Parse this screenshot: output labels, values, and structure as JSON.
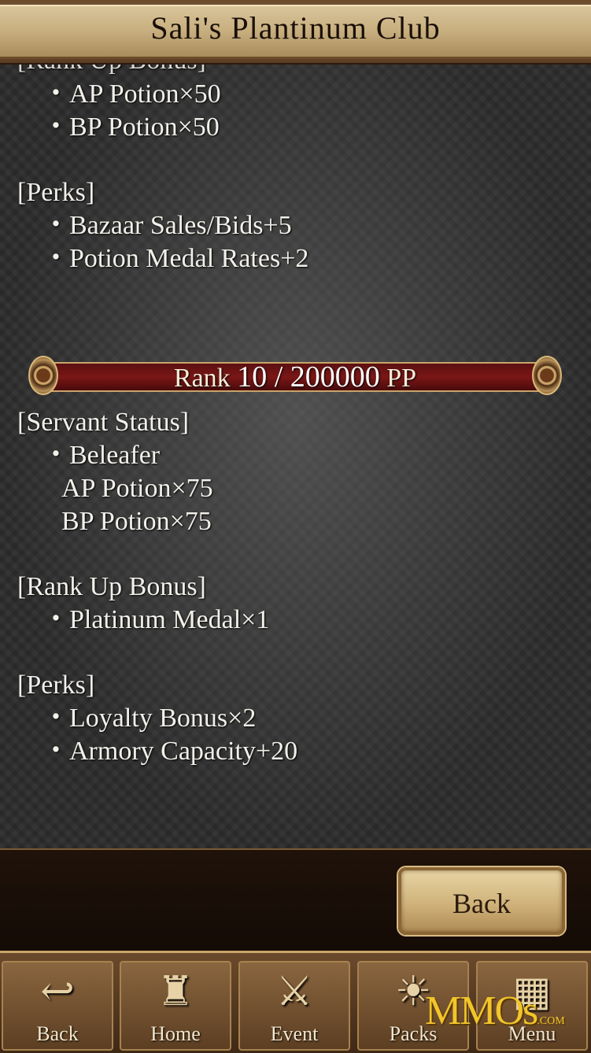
{
  "header": {
    "title": "Sali's Plantinum Club"
  },
  "content": {
    "cut_heading": "[Rank Up Bonus]",
    "prev_bonus_items": [
      "・AP Potion×50",
      "・BP Potion×50"
    ],
    "prev_perks_heading": "[Perks]",
    "prev_perks": [
      "・Bazaar Sales/Bids+5",
      "・Potion Medal Rates+2"
    ],
    "rank": {
      "label": "Rank",
      "value": "10 / 200000",
      "unit": "PP"
    },
    "servant_heading": "[Servant Status]",
    "servant_items": [
      "・Beleafer",
      "AP Potion×75",
      "BP Potion×75"
    ],
    "bonus_heading": "[Rank Up Bonus]",
    "bonus_items": [
      "・Platinum Medal×1"
    ],
    "perks_heading": "[Perks]",
    "perks": [
      "・Loyalty Bonus×2",
      "・Armory Capacity+20"
    ]
  },
  "footer": {
    "back_label": "Back"
  },
  "nav": [
    {
      "label": "Back",
      "icon": "return-arrow-icon",
      "glyph": "↩"
    },
    {
      "label": "Home",
      "icon": "castle-icon",
      "glyph": "♜"
    },
    {
      "label": "Event",
      "icon": "crossed-swords-icon",
      "glyph": "⚔"
    },
    {
      "label": "Packs",
      "icon": "sun-gear-icon",
      "glyph": "☀"
    },
    {
      "label": "Menu",
      "icon": "grid-menu-icon",
      "glyph": "▦"
    }
  ],
  "watermark": {
    "text": "MMOs",
    "suffix": ".COM"
  }
}
